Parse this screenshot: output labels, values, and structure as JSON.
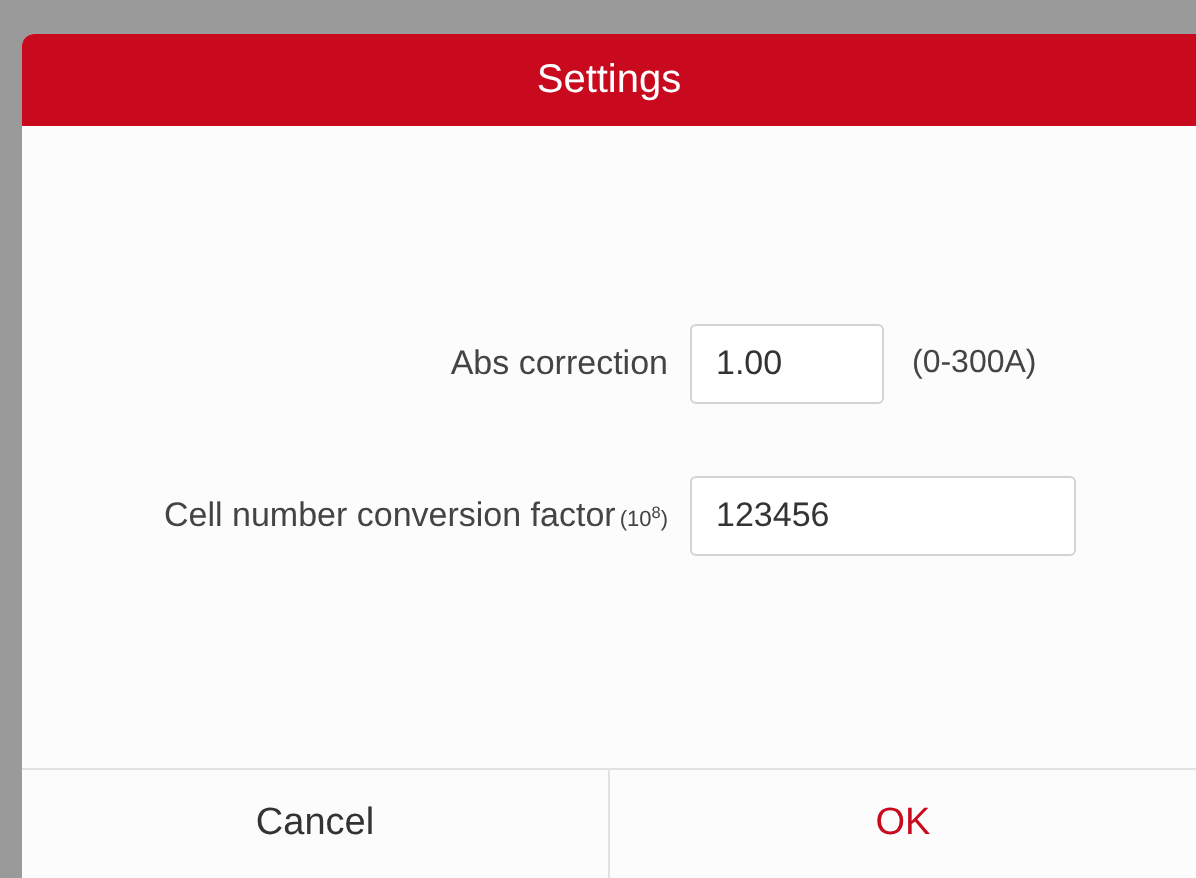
{
  "dialog": {
    "title": "Settings",
    "fields": [
      {
        "label": "Abs correction",
        "value": "1.00",
        "kind": "short",
        "unit": "(0-300A)"
      },
      {
        "label": "Cell number conversion factor",
        "label_note": "(10$^{8}$)",
        "value": "123456",
        "kind": "long"
      }
    ],
    "buttons": [
      {
        "label": "Cancel",
        "kind": "cancel"
      },
      {
        "label": "OK",
        "kind": "confirm"
      }
    ]
  }
}
